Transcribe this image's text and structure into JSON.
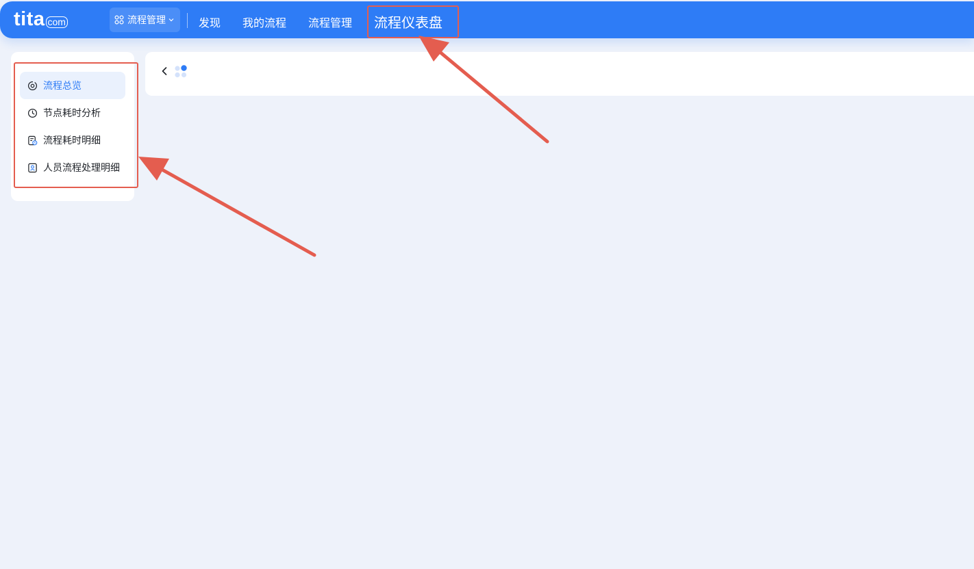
{
  "header": {
    "logo_main": "tita",
    "logo_suffix": "com",
    "module_switch_label": "流程管理",
    "nav": [
      {
        "label": "发现"
      },
      {
        "label": "我的流程"
      },
      {
        "label": "流程管理"
      },
      {
        "label": "流程仪表盘"
      }
    ],
    "active_nav": "流程仪表盘"
  },
  "sidebar": {
    "items": [
      {
        "label": "流程总览",
        "icon": "overview-icon",
        "active": true
      },
      {
        "label": "节点耗时分析",
        "icon": "clock-icon",
        "active": false
      },
      {
        "label": "流程耗时明细",
        "icon": "document-clock-icon",
        "active": false
      },
      {
        "label": "人员流程处理明细",
        "icon": "person-card-icon",
        "active": false
      }
    ]
  },
  "colors": {
    "brand_blue": "#2e7cf6",
    "page_bg": "#eef2fa",
    "annotation_red": "#e45d4f"
  }
}
